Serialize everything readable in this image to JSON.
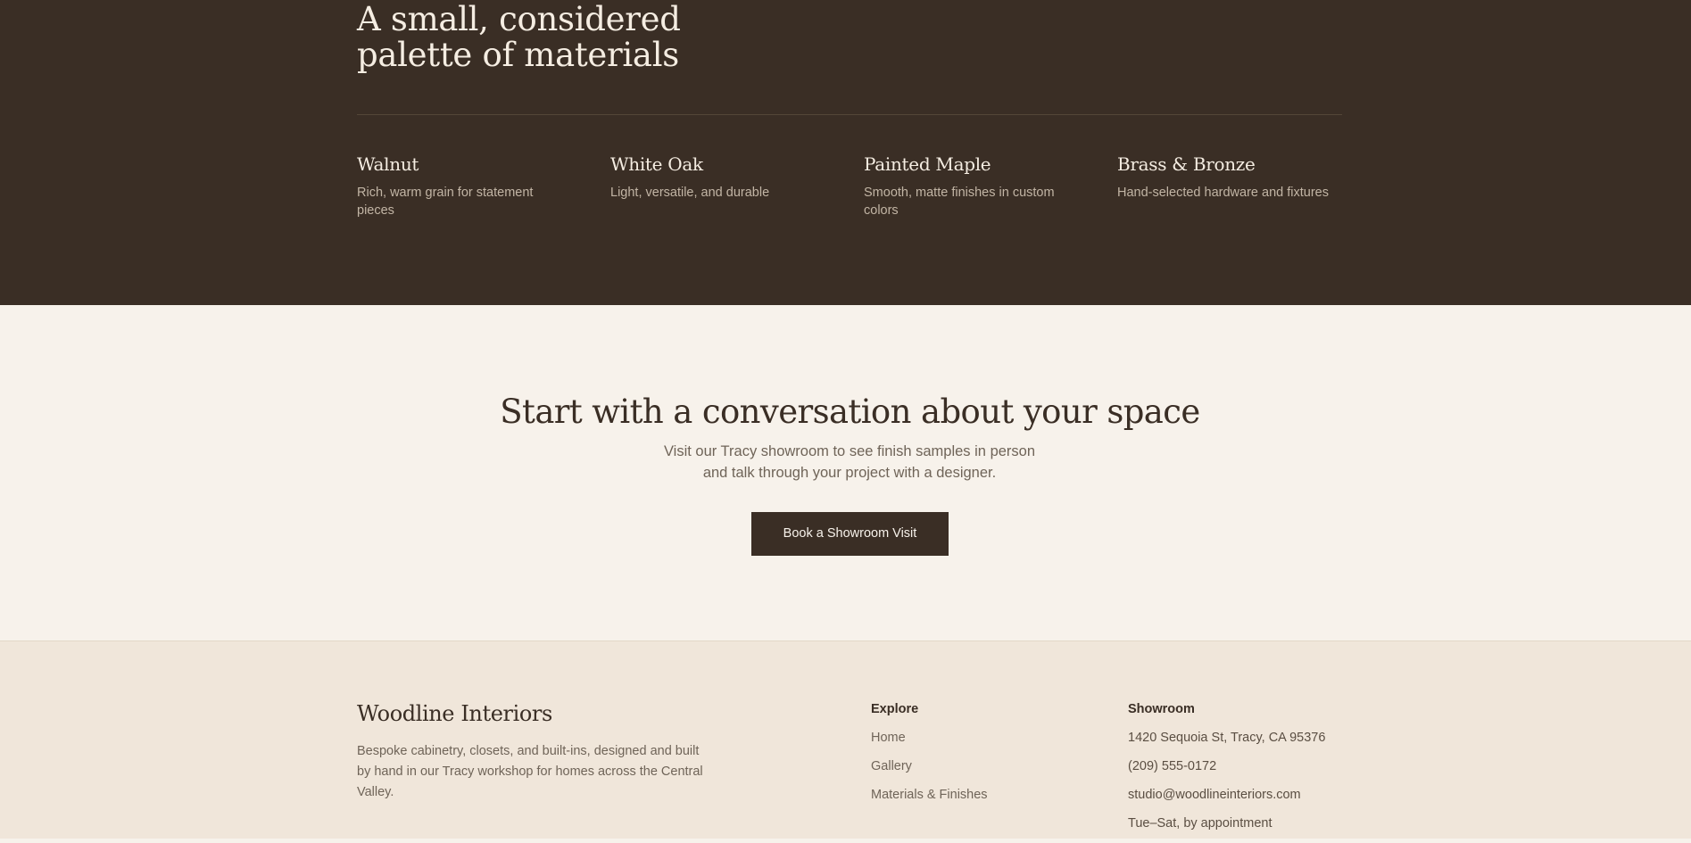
{
  "materials": {
    "title_line1": "A small, considered",
    "title_line2": "palette of materials",
    "items": [
      {
        "name": "Walnut",
        "desc": "Rich, warm grain for statement pieces"
      },
      {
        "name": "White Oak",
        "desc": "Light, versatile, and durable"
      },
      {
        "name": "Painted Maple",
        "desc": "Smooth, matte finishes in custom colors"
      },
      {
        "name": "Brass & Bronze",
        "desc": "Hand-selected hardware and fixtures"
      }
    ]
  },
  "cta": {
    "title": "Start with a conversation about your space",
    "text": "Visit our Tracy showroom to see finish samples in person and talk through your project with a designer.",
    "button_label": "Book a Showroom Visit"
  },
  "footer": {
    "brand": "Woodline Interiors",
    "description": "Bespoke cabinetry, closets, and built-ins, designed and built by hand in our Tracy workshop for homes across the Central Valley.",
    "explore": {
      "heading": "Explore",
      "links": [
        "Home",
        "Gallery",
        "Materials & Finishes"
      ]
    },
    "showroom": {
      "heading": "Showroom",
      "address": "1420 Sequoia St, Tracy, CA 95376",
      "phone": "(209) 555-0172",
      "email": "studio@woodlineinteriors.com",
      "hours": "Tue–Sat, by appointment"
    }
  },
  "colors": {
    "dark_brown": "#3a2e25",
    "cream": "#f7f2eb",
    "footer_bg": "#f0e6da",
    "muted_text": "#6f6458"
  }
}
